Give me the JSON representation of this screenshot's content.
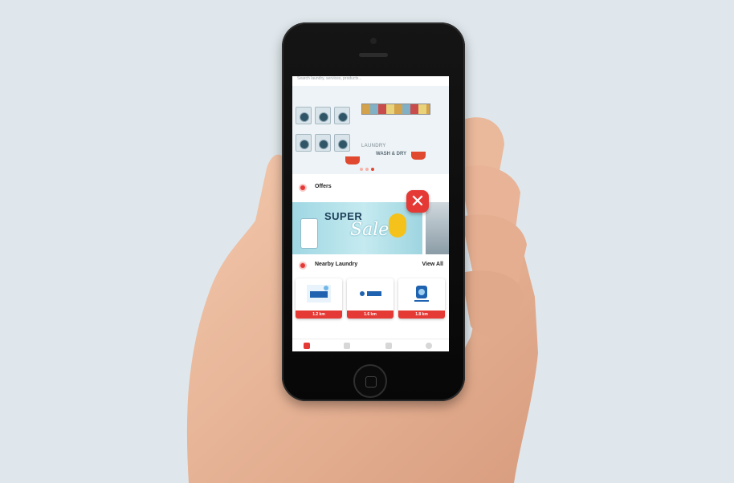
{
  "search_hint": "Search laundry, services, products...",
  "banner": {
    "label": "LAUNDRY",
    "title": "WASH & DRY"
  },
  "offers": {
    "title": "Offers",
    "promo_word_1": "SUPER",
    "promo_word_2": "Sale"
  },
  "nearby": {
    "title": "Nearby Laundry",
    "view_all": "View All",
    "cards": [
      {
        "distance": "1.2 km"
      },
      {
        "distance": "1.6 km"
      },
      {
        "distance": "1.8 km"
      }
    ]
  },
  "bottom_nav": [
    "home-icon",
    "search-icon",
    "orders-icon",
    "profile-icon"
  ],
  "colors": {
    "accent": "#e53935",
    "background": "#dfe7ec"
  }
}
